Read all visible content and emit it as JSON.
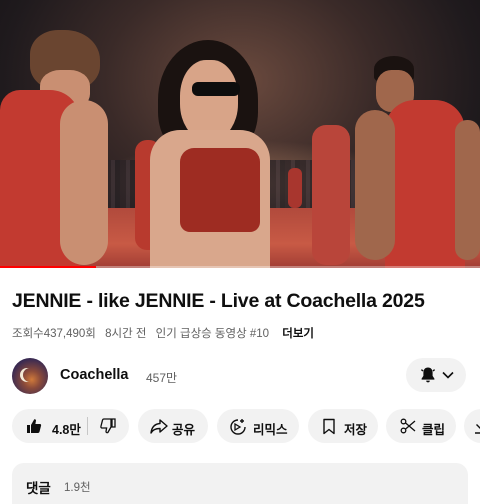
{
  "video": {
    "progress": 0.2,
    "accent_color": "#ff0000"
  },
  "title": "JENNIE - like JENNIE - Live at Coachella 2025",
  "meta": {
    "views": "조회수437,490회",
    "time": "8시간 전",
    "trending": "인기 급상승 동영상 #10",
    "more": "더보기"
  },
  "channel": {
    "name": "Coachella",
    "subscribers": "457만",
    "bell_icon": "bell-icon",
    "chevron_icon": "chevron-down-icon"
  },
  "actions": {
    "like_count": "4.8만",
    "share": "공유",
    "remix": "리믹스",
    "save": "저장",
    "clip": "클립"
  },
  "comments": {
    "label": "댓글",
    "count": "1.9천"
  }
}
